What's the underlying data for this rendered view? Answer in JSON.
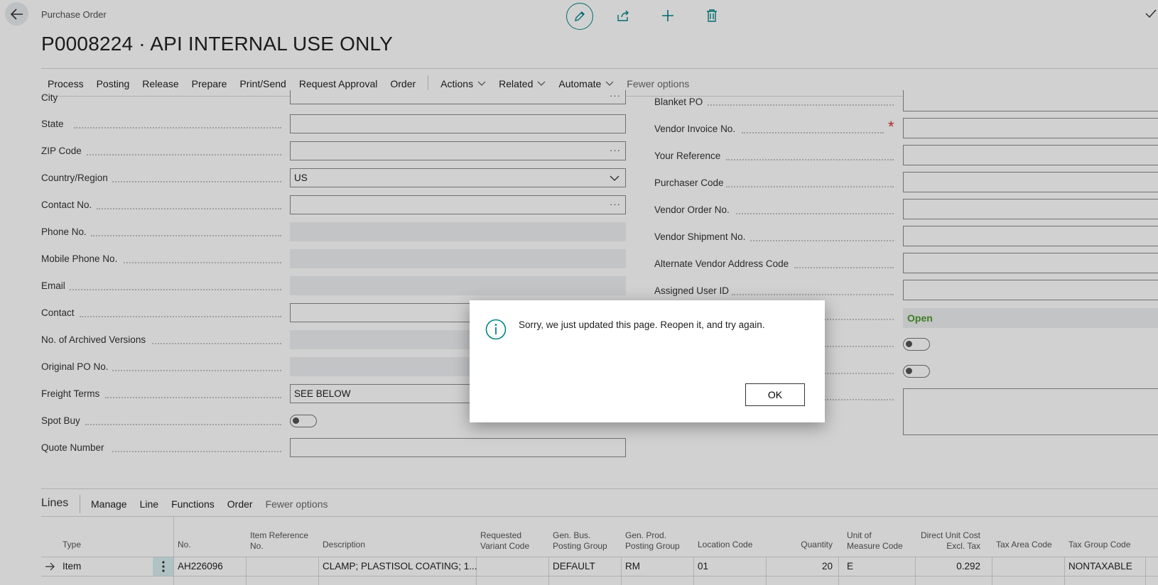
{
  "header": {
    "breadcrumb": "Purchase Order",
    "title": "P0008224 · API INTERNAL USE ONLY"
  },
  "actions": {
    "items": [
      "Process",
      "Posting",
      "Release",
      "Prepare",
      "Print/Send",
      "Request Approval",
      "Order"
    ],
    "menus": [
      "Actions",
      "Related",
      "Automate"
    ],
    "fewer": "Fewer options"
  },
  "left_fields": {
    "city": "City",
    "state": "State",
    "zip": "ZIP Code",
    "country": "Country/Region",
    "country_value": "US",
    "contact_no": "Contact No.",
    "phone": "Phone No.",
    "mobile": "Mobile Phone No.",
    "email": "Email",
    "contact": "Contact",
    "archived": "No. of Archived Versions",
    "orig_po": "Original PO No.",
    "freight": "Freight Terms",
    "freight_value": "SEE BELOW",
    "spot_buy": "Spot Buy",
    "quote": "Quote Number"
  },
  "right_fields": {
    "blanket": "Blanket PO",
    "vendor_invoice": "Vendor Invoice No.",
    "your_ref": "Your Reference",
    "purchaser": "Purchaser Code",
    "vendor_order": "Vendor Order No.",
    "vendor_shipment": "Vendor Shipment No.",
    "alt_vendor": "Alternate Vendor Address Code",
    "assigned_user": "Assigned User ID",
    "status_value": "Open",
    "required_mark": "*"
  },
  "lines": {
    "title": "Lines",
    "menu": [
      "Manage",
      "Line",
      "Functions",
      "Order"
    ],
    "fewer": "Fewer options",
    "columns": {
      "type": "Type",
      "no": "No.",
      "item_ref_1": "Item Reference",
      "item_ref_2": "No.",
      "desc": "Description",
      "req_var_1": "Requested",
      "req_var_2": "Variant Code",
      "gen_bus_1": "Gen. Bus.",
      "gen_bus_2": "Posting Group",
      "gen_prod_1": "Gen. Prod.",
      "gen_prod_2": "Posting Group",
      "location": "Location Code",
      "qty": "Quantity",
      "uom_1": "Unit of",
      "uom_2": "Measure Code",
      "cost_1": "Direct Unit Cost",
      "cost_2": "Excl. Tax",
      "tax_area": "Tax Area Code",
      "tax_group": "Tax Group Code"
    },
    "row": {
      "type": "Item",
      "no": "AH226096",
      "desc": "CLAMP; PLASTISOL COATING; 1...",
      "gen_bus": "DEFAULT",
      "gen_prod": "RM",
      "location": "01",
      "qty": "20",
      "uom": "E",
      "cost": "0.292",
      "tax_group": "NONTAXABLE"
    }
  },
  "dialog": {
    "message": "Sorry, we just updated this page. Reopen it, and try again.",
    "ok": "OK"
  }
}
